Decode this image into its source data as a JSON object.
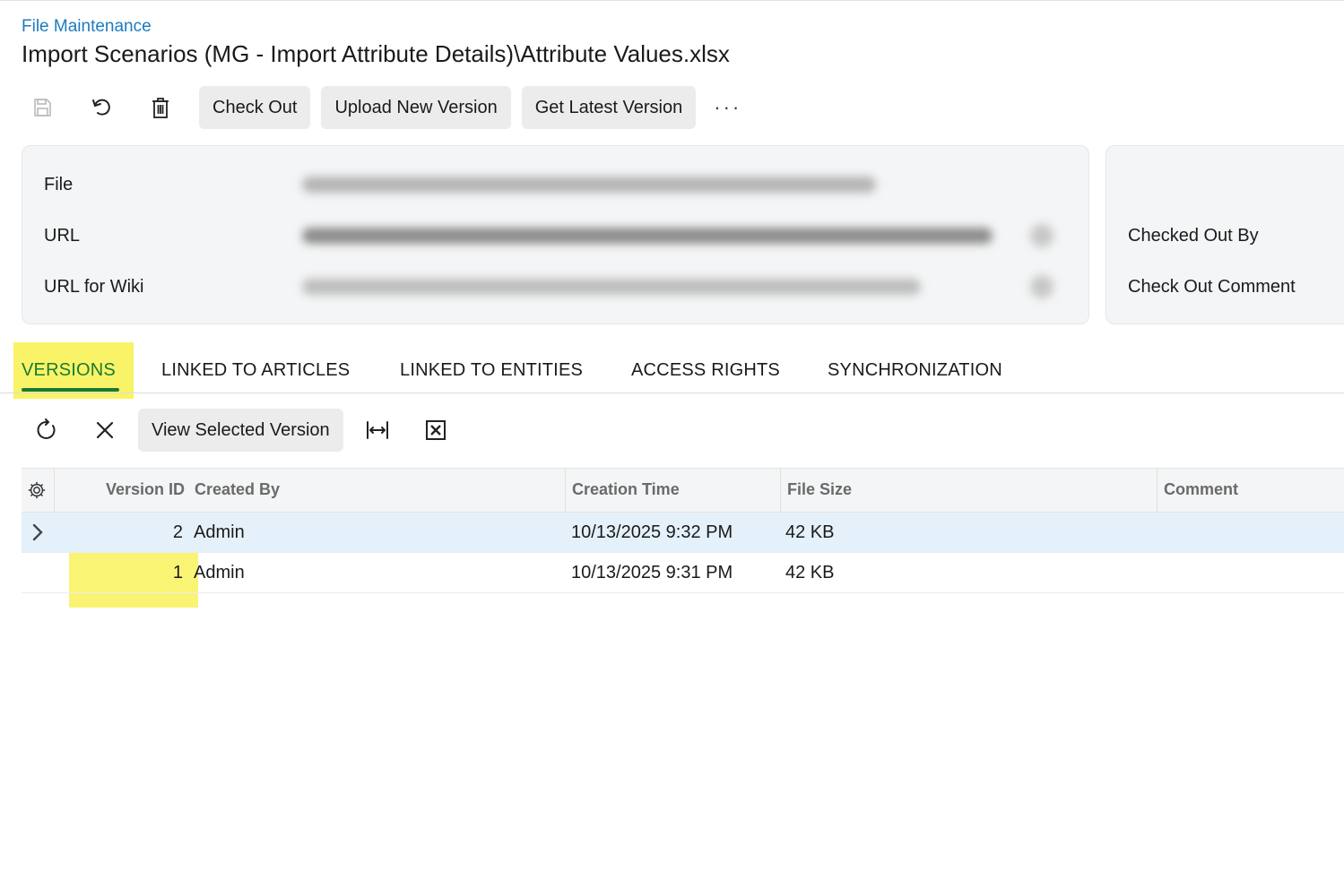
{
  "breadcrumb": "File Maintenance",
  "title": "Import Scenarios (MG - Import Attribute Details)\\Attribute Values.xlsx",
  "toolbar": {
    "save_icon": "save-icon",
    "undo_icon": "undo-icon",
    "delete_icon": "trash-icon",
    "check_out": "Check Out",
    "upload_new_version": "Upload New Version",
    "get_latest_version": "Get Latest Version",
    "more": "···"
  },
  "form": {
    "file_label": "File",
    "url_label": "URL",
    "url_wiki_label": "URL for Wiki",
    "checked_out_by_label": "Checked Out By",
    "check_out_comment_label": "Check Out Comment"
  },
  "tabs": [
    "VERSIONS",
    "LINKED TO ARTICLES",
    "LINKED TO ENTITIES",
    "ACCESS RIGHTS",
    "SYNCHRONIZATION"
  ],
  "active_tab": "VERSIONS",
  "grid_toolbar": {
    "refresh_icon": "refresh-icon",
    "delete_icon": "close-icon",
    "view_selected_version": "View Selected Version",
    "fit_icon": "fit-columns-icon",
    "excel_icon": "excel-export-icon"
  },
  "grid": {
    "columns": [
      "Version ID",
      "Created By",
      "Creation Time",
      "File Size",
      "Comment"
    ],
    "rows": [
      {
        "version_id": "2",
        "created_by": "Admin",
        "creation_time": "10/13/2025 9:32 PM",
        "file_size": "42 KB",
        "comment": ""
      },
      {
        "version_id": "1",
        "created_by": "Admin",
        "creation_time": "10/13/2025 9:31 PM",
        "file_size": "42 KB",
        "comment": ""
      }
    ]
  },
  "colors": {
    "accent_link": "#1b7bbf",
    "active_tab": "#1a7a33",
    "highlight": "#f8f25a",
    "selected_row": "#e5f1fa"
  }
}
